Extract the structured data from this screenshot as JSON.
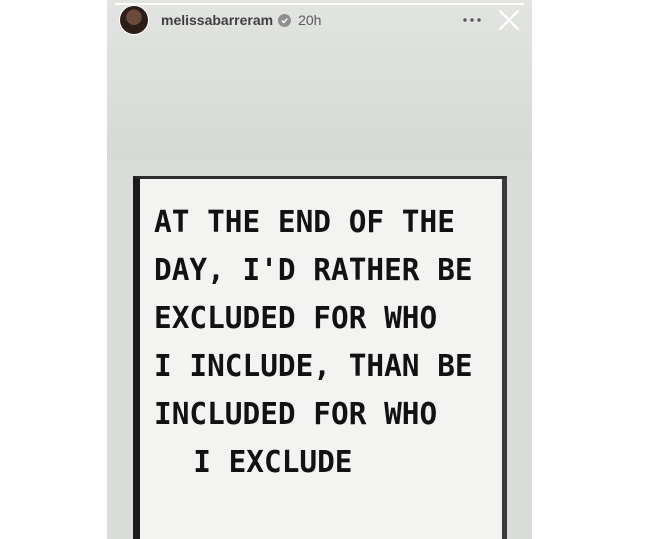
{
  "story": {
    "progress": 1.0,
    "header": {
      "username": "melissabarreram",
      "verified": true,
      "time_ago": "20h",
      "more_icon": "more-horizontal-icon",
      "close_icon": "close-icon"
    },
    "image": {
      "sign_lines": [
        "AT THE END OF THE",
        "DAY, I'D RATHER BE",
        "EXCLUDED FOR WHO",
        "I INCLUDE, THAN BE",
        "INCLUDED FOR WHO",
        "I EXCLUDE"
      ]
    }
  },
  "colors": {
    "story_background": "#d9dcd8",
    "sign_background": "#f3f3f1",
    "letter_color": "#121212"
  }
}
